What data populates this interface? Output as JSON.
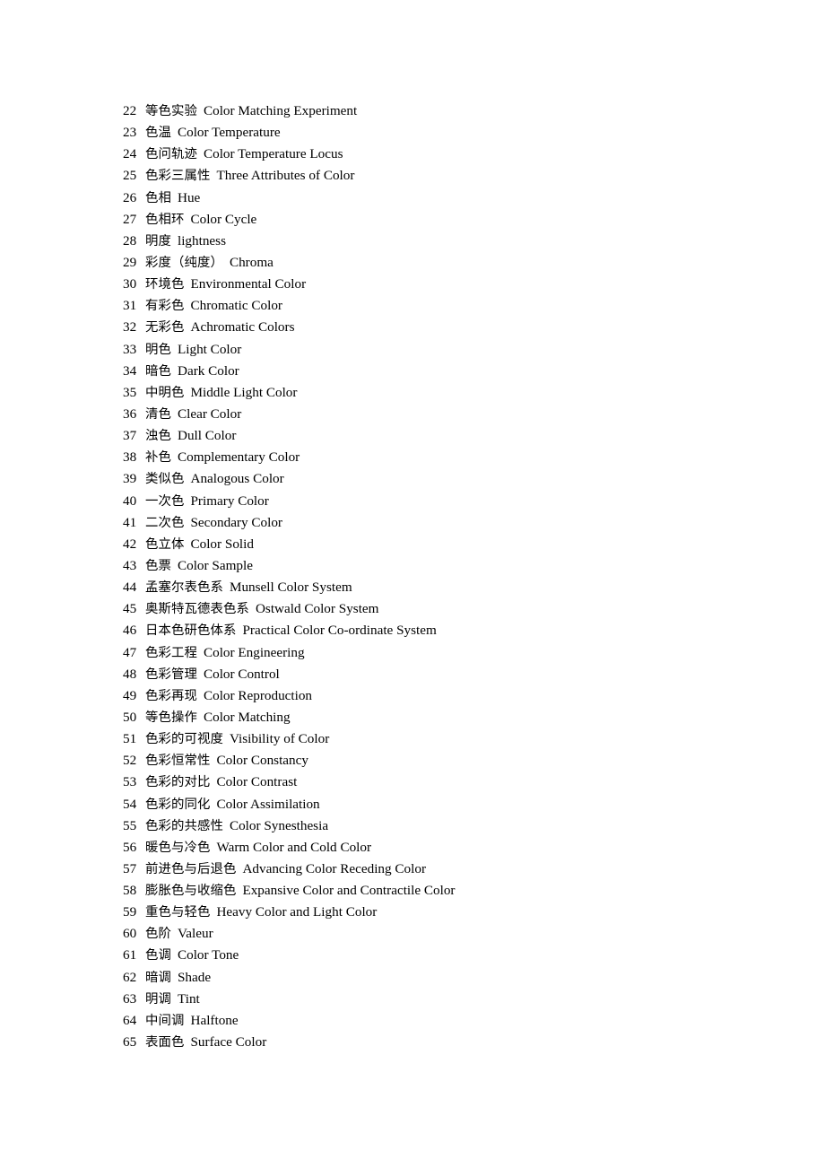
{
  "document": {
    "background_color": "#ffffff",
    "text_color": "#000000",
    "header_text": "",
    "footer_text": ""
  },
  "glossary": {
    "entries": [
      {
        "num": "22",
        "zh": "等色实验",
        "en": "Color Matching Experiment"
      },
      {
        "num": "23",
        "zh": "色温",
        "en": "Color Temperature"
      },
      {
        "num": "24",
        "zh": "色问轨迹",
        "en": "Color Temperature Locus"
      },
      {
        "num": "25",
        "zh": "色彩三属性",
        "en": "Three Attributes of Color"
      },
      {
        "num": "26",
        "zh": "色相",
        "en": "Hue"
      },
      {
        "num": "27",
        "zh": "色相环",
        "en": "Color Cycle"
      },
      {
        "num": "28",
        "zh": "明度",
        "en": "lightness"
      },
      {
        "num": "29",
        "zh": "彩度（纯度）",
        "en": "Chroma"
      },
      {
        "num": "30",
        "zh": "环境色",
        "en": "Environmental Color"
      },
      {
        "num": "31",
        "zh": "有彩色",
        "en": "Chromatic Color"
      },
      {
        "num": "32",
        "zh": "无彩色",
        "en": "Achromatic Colors"
      },
      {
        "num": "33",
        "zh": "明色",
        "en": "Light Color"
      },
      {
        "num": "34",
        "zh": "暗色",
        "en": "Dark Color"
      },
      {
        "num": "35",
        "zh": "中明色",
        "en": "Middle Light Color"
      },
      {
        "num": "36",
        "zh": "清色",
        "en": "Clear Color"
      },
      {
        "num": "37",
        "zh": "浊色",
        "en": "Dull Color"
      },
      {
        "num": "38",
        "zh": "补色",
        "en": "Complementary Color"
      },
      {
        "num": "39",
        "zh": "类似色",
        "en": "Analogous Color"
      },
      {
        "num": "40",
        "zh": "一次色",
        "en": "Primary Color"
      },
      {
        "num": "41",
        "zh": "二次色",
        "en": "Secondary Color"
      },
      {
        "num": "42",
        "zh": "色立体",
        "en": "Color Solid"
      },
      {
        "num": "43",
        "zh": "色票",
        "en": "Color Sample"
      },
      {
        "num": "44",
        "zh": "孟塞尔表色系",
        "en": "Munsell Color System"
      },
      {
        "num": "45",
        "zh": "奥斯特瓦德表色系",
        "en": "Ostwald Color System"
      },
      {
        "num": "46",
        "zh": "日本色研色体系",
        "en": "Practical Color Co-ordinate System"
      },
      {
        "num": "47",
        "zh": "色彩工程",
        "en": "Color Engineering"
      },
      {
        "num": "48",
        "zh": "色彩管理",
        "en": "Color Control"
      },
      {
        "num": "49",
        "zh": "色彩再现",
        "en": "Color Reproduction"
      },
      {
        "num": "50",
        "zh": "等色操作",
        "en": "Color Matching"
      },
      {
        "num": "51",
        "zh": "色彩的可视度",
        "en": "Visibility of Color"
      },
      {
        "num": "52",
        "zh": "色彩恒常性",
        "en": "Color Constancy"
      },
      {
        "num": "53",
        "zh": "色彩的对比",
        "en": "Color Contrast"
      },
      {
        "num": "54",
        "zh": "色彩的同化",
        "en": "Color Assimilation"
      },
      {
        "num": "55",
        "zh": "色彩的共感性",
        "en": "Color Synesthesia"
      },
      {
        "num": "56",
        "zh": "暖色与冷色",
        "en": "Warm Color and Cold Color"
      },
      {
        "num": "57",
        "zh": "前进色与后退色",
        "en": "Advancing Color Receding Color"
      },
      {
        "num": "58",
        "zh": "膨胀色与收缩色",
        "en": "Expansive Color and Contractile Color"
      },
      {
        "num": "59",
        "zh": "重色与轻色",
        "en": "Heavy Color and Light Color"
      },
      {
        "num": "60",
        "zh": "色阶",
        "en": "Valeur"
      },
      {
        "num": "61",
        "zh": "色调",
        "en": "Color Tone"
      },
      {
        "num": "62",
        "zh": "暗调",
        "en": "Shade"
      },
      {
        "num": "63",
        "zh": "明调",
        "en": "Tint"
      },
      {
        "num": "64",
        "zh": "中间调",
        "en": "Halftone"
      },
      {
        "num": "65",
        "zh": "表面色",
        "en": "Surface Color"
      }
    ]
  }
}
